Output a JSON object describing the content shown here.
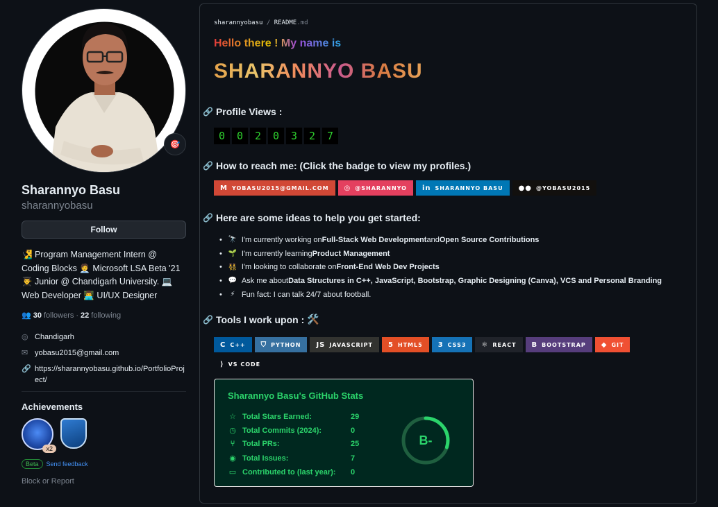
{
  "profile": {
    "name": "Sharannyo Basu",
    "login": "sharannyobasu",
    "status_emoji": "🎯",
    "follow_label": "Follow",
    "bio": "🧏‍♂️ Program Management Intern @ Coding Blocks 🧑‍💼 Microsoft LSA Beta '21 👨‍🎓 Junior @ Chandigarh University. 💻 Web Developer 👨‍💻 UI/UX Designer",
    "followers_count": "30",
    "followers_label": "followers",
    "separator": "·",
    "following_count": "22",
    "following_label": "following",
    "location": "Chandigarh",
    "email": "yobasu2015@gmail.com",
    "website": "https://sharannyobasu.github.io/PortfolioProject/",
    "achievements_title": "Achievements",
    "achievement_multiplier": "x2",
    "beta_label": "Beta",
    "feedback_label": "Send feedback",
    "report_label": "Block or Report"
  },
  "readme": {
    "crumb_user": "sharannyobasu",
    "crumb_sep": "/",
    "crumb_file": "README",
    "crumb_ext": ".md",
    "hello": "Hello there ! My name is",
    "big_name": "SHARANNYO BASU",
    "profile_views_heading": "Profile Views :",
    "profile_views_digits": [
      "0",
      "0",
      "2",
      "0",
      "3",
      "2",
      "7"
    ],
    "reach_heading": "How to reach me: (Click the badge to view my profiles.)",
    "social_badges": [
      {
        "label": "YOBASU2015@GMAIL.COM",
        "icon": "gmail-icon",
        "color": "#d14836"
      },
      {
        "label": "@SHARANNYO",
        "icon": "instagram-icon",
        "color": "#e4405f"
      },
      {
        "label": "SHARANNYO BASU",
        "icon": "linkedin-icon",
        "color": "#0077b5"
      },
      {
        "label": "@YOBASU2015",
        "icon": "medium-icon",
        "color": "#12100e"
      }
    ],
    "ideas_heading": "Here are some ideas to help you get started:",
    "ideas": [
      {
        "emoji": "🔭",
        "prefix": "I'm currently working on ",
        "bold1": "Full-Stack Web Development",
        "mid": " and ",
        "bold2": "Open Source Contributions",
        "suffix": ""
      },
      {
        "emoji": "🌱",
        "prefix": "I'm currently learning ",
        "bold1": "Product Management",
        "mid": "",
        "bold2": "",
        "suffix": ""
      },
      {
        "emoji": "👯",
        "prefix": "I'm looking to collaborate on ",
        "bold1": "Front-End Web Dev Projects",
        "mid": "",
        "bold2": "",
        "suffix": ""
      },
      {
        "emoji": "💬",
        "prefix": "Ask me about ",
        "bold1": "Data Structures in C++, JavaScript, Bootstrap, Graphic Designing (Canva), VCS and Personal Branding",
        "mid": "",
        "bold2": "",
        "suffix": ""
      },
      {
        "emoji": "⚡",
        "prefix": "Fun fact: I can talk 24/7 about football.",
        "bold1": "",
        "mid": "",
        "bold2": "",
        "suffix": ""
      }
    ],
    "tools_heading": "Tools I work upon :",
    "tools_emoji": "🛠️",
    "tool_badges": [
      {
        "label": "C++",
        "icon": "cpp-icon",
        "color": "#00599c"
      },
      {
        "label": "PYTHON",
        "icon": "python-icon",
        "color": "#3670a0"
      },
      {
        "label": "JAVASCRIPT",
        "icon": "javascript-icon",
        "color": "#323330"
      },
      {
        "label": "HTML5",
        "icon": "html5-icon",
        "color": "#e34f26"
      },
      {
        "label": "CSS3",
        "icon": "css3-icon",
        "color": "#1572b6"
      },
      {
        "label": "REACT",
        "icon": "react-icon",
        "color": "#20232a"
      },
      {
        "label": "BOOTSTRAP",
        "icon": "bootstrap-icon",
        "color": "#563d7c"
      },
      {
        "label": "GIT",
        "icon": "git-icon",
        "color": "#f05033"
      },
      {
        "label": "VS CODE",
        "icon": "vscode-icon",
        "color": "#0d1117"
      }
    ],
    "stats": {
      "title": "Sharannyo Basu's GitHub Stats",
      "rows": [
        {
          "label": "Total Stars Earned:",
          "value": "29",
          "icon": "star-icon"
        },
        {
          "label": "Total Commits (2024):",
          "value": "0",
          "icon": "history-icon"
        },
        {
          "label": "Total PRs:",
          "value": "25",
          "icon": "pull-request-icon"
        },
        {
          "label": "Total Issues:",
          "value": "7",
          "icon": "issue-icon"
        },
        {
          "label": "Contributed to (last year):",
          "value": "0",
          "icon": "repo-icon"
        }
      ],
      "rank": "B-",
      "rank_progress": 0.3,
      "color": "#2bd46b",
      "background": "#00281f"
    }
  }
}
